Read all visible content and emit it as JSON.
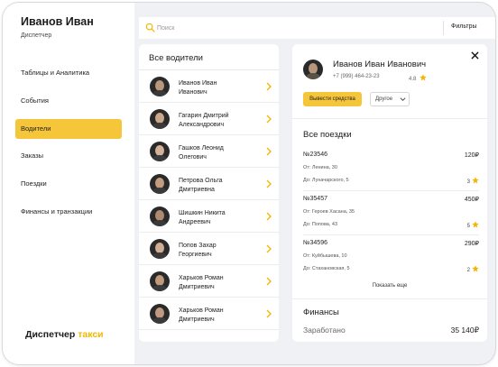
{
  "user": {
    "name": "Иванов Иван",
    "role": "Диспетчер"
  },
  "nav": {
    "items": [
      {
        "label": "Таблицы и Аналитика"
      },
      {
        "label": "События"
      },
      {
        "label": "Водители"
      },
      {
        "label": "Заказы"
      },
      {
        "label": "Поездки"
      },
      {
        "label": "Финансы и транзакции"
      }
    ],
    "active_index": 2
  },
  "brand": {
    "prefix": "Диспетчер",
    "accent": "такси"
  },
  "search": {
    "placeholder": "Поиск",
    "value": "",
    "filters_label": "Фильтры"
  },
  "drivers": {
    "title": "Все водители",
    "items": [
      {
        "line1": "Иванов Иван",
        "line2": "Иванович"
      },
      {
        "line1": "Гагарин Дмитрий",
        "line2": "Александрович"
      },
      {
        "line1": "Гашков Леонид",
        "line2": "Олегович"
      },
      {
        "line1": "Петрова Ольга",
        "line2": "Дмитриевна"
      },
      {
        "line1": "Шишкин Никита",
        "line2": "Андреевич"
      },
      {
        "line1": "Попов Захар",
        "line2": "Георгиевич"
      },
      {
        "line1": "Харьков Роман",
        "line2": "Дмитриевич"
      },
      {
        "line1": "Харьков Роман",
        "line2": "Дмитриевич"
      }
    ]
  },
  "detail": {
    "name": "Иванов Иван Иванович",
    "phone": "+7 (999) 464-23-23",
    "rating": "4.8",
    "withdraw_label": "Вывести средства",
    "other_label": "Другое",
    "trips_title": "Все поездки",
    "trips": [
      {
        "id": "№23546",
        "price": "120₽",
        "from": "От:  Ленина, 30",
        "to": "До:  Луначарского, 5",
        "rating": "3"
      },
      {
        "id": "№35457",
        "price": "450₽",
        "from": "От:  Героев Хасана, 35",
        "to": "До:  Попова, 43",
        "rating": "5"
      },
      {
        "id": "№34596",
        "price": "290₽",
        "from": "От:  Куйбышева, 10",
        "to": "До:  Стахановская, 5",
        "rating": "2"
      }
    ],
    "show_more": "Показать еще",
    "finance_title": "Финансы",
    "earned_label": "Заработано",
    "earned_value": "35 140₽"
  },
  "colors": {
    "accent": "#f5c63a",
    "star": "#f2b705",
    "background": "#f0f1f4"
  },
  "icons": {
    "search": "search-icon",
    "chevron": "chevron-right-icon",
    "close": "close-icon",
    "star": "star-icon",
    "dropdown": "chevron-down-icon"
  }
}
